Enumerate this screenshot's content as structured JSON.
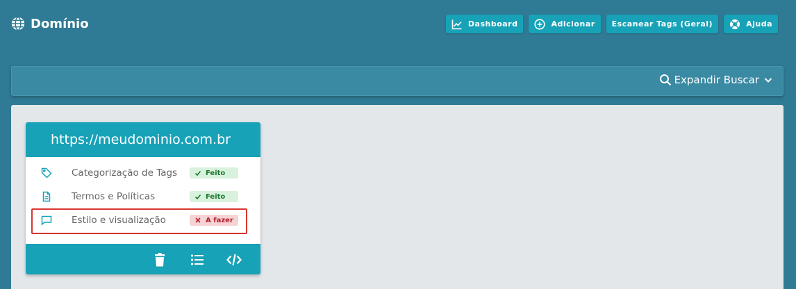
{
  "header": {
    "title": "Domínio",
    "icon": "globe-icon",
    "buttons": [
      {
        "label": "Dashboard",
        "icon": "chart-line-icon"
      },
      {
        "label": "Adicionar",
        "icon": "plus-circle-icon"
      },
      {
        "label": "Escanear Tags (Geral)",
        "icon": ""
      },
      {
        "label": "Ajuda",
        "icon": "lifebuoy-icon"
      }
    ]
  },
  "search": {
    "label": "Expandir Buscar",
    "icon": "search-icon",
    "chevron": "chevron-down-icon"
  },
  "card": {
    "url": "https://meudominio.com.br",
    "tasks": [
      {
        "label": "Categorização de Tags",
        "status": "Feito",
        "state": "done",
        "icon": "tag-icon"
      },
      {
        "label": "Termos e Políticas",
        "status": "Feito",
        "state": "done",
        "icon": "document-icon"
      },
      {
        "label": "Estilo e visualização",
        "status": "A fazer",
        "state": "todo",
        "icon": "chat-icon"
      }
    ],
    "footer": [
      "trash-icon",
      "list-icon",
      "code-icon"
    ]
  },
  "colors": {
    "background": "#2f7a94",
    "accent": "#17a2b8",
    "panel": "#e3e7ea",
    "done_bg": "#d9f2dd",
    "done_text": "#1e7a34",
    "todo_bg": "#f6d3d5",
    "todo_text": "#b0202e",
    "highlight": "#d9352f"
  }
}
